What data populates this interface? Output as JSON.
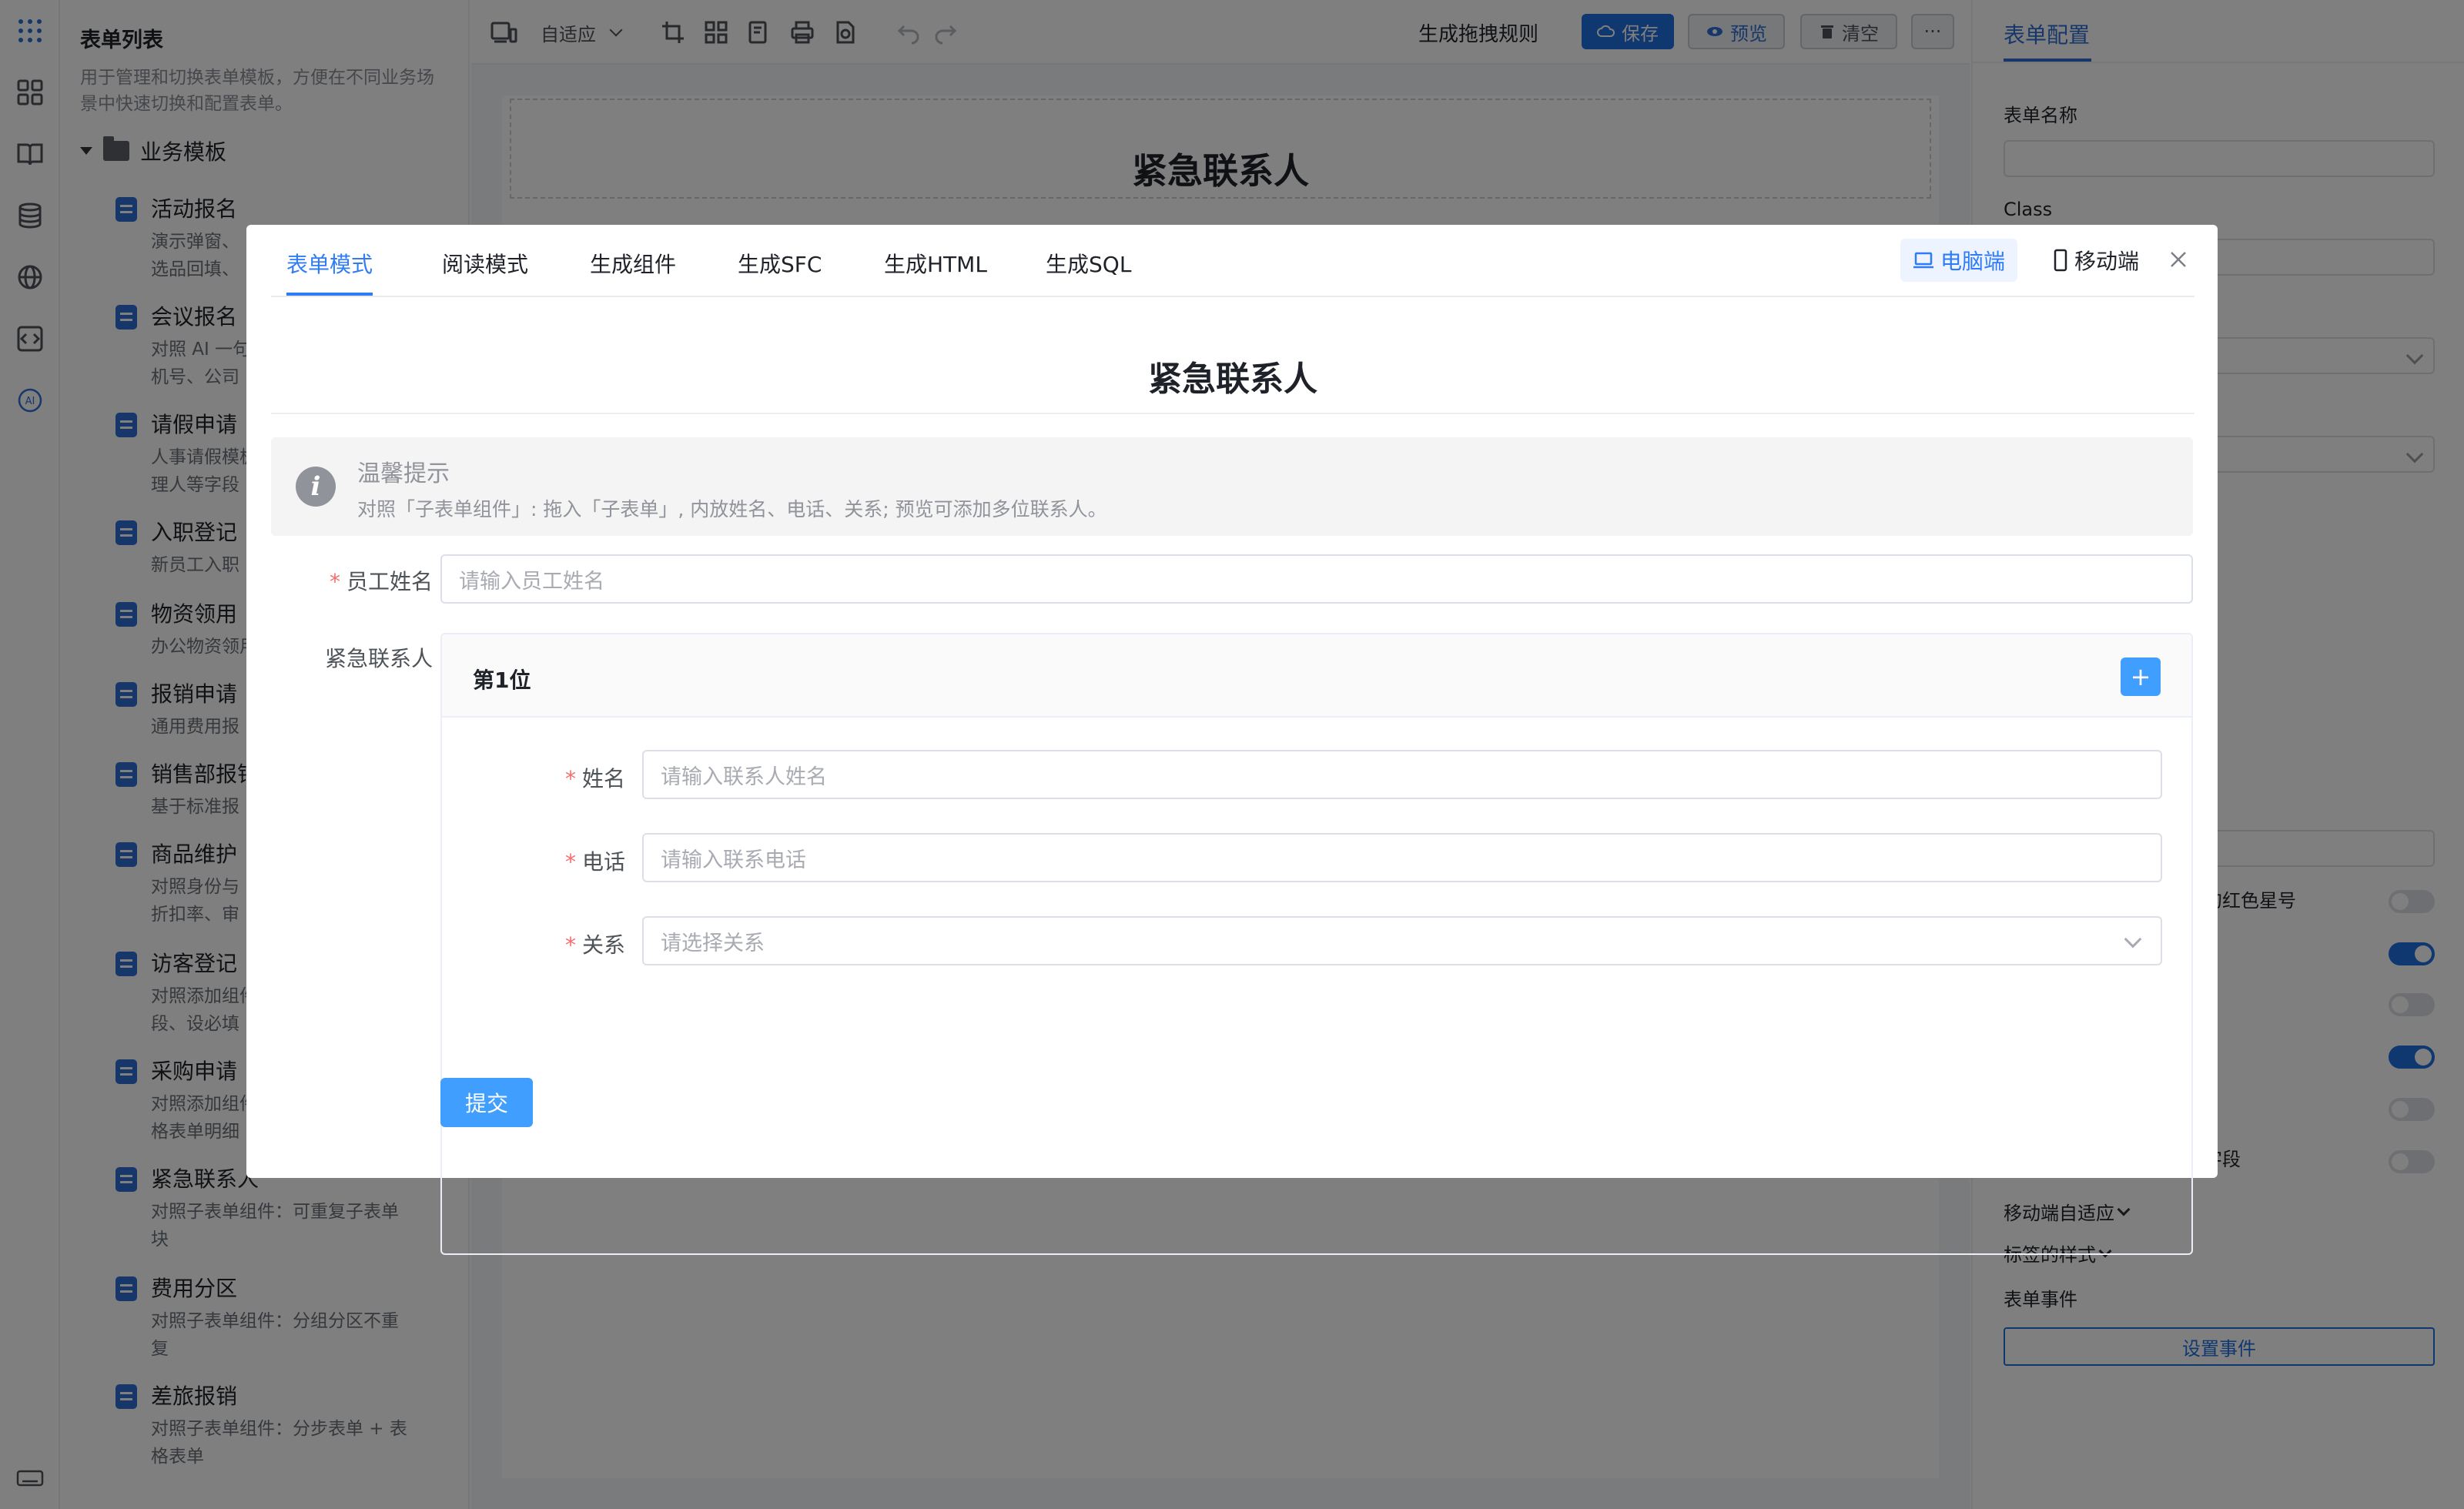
{
  "rail": {
    "icons": [
      "apps-grid-icon",
      "dashboard-icon",
      "book-icon",
      "database-icon",
      "globe-icon",
      "code-icon",
      "ai-icon",
      "keyboard-icon"
    ]
  },
  "tree": {
    "title": "表单列表",
    "desc": "用于管理和切换表单模板，方便在不同业务场景中快速切换和配置表单。",
    "group": "业务模板",
    "items": [
      {
        "name": "活动报名",
        "desc": "演示弹窗、\n选品回填、"
      },
      {
        "name": "会议报名",
        "desc": "对照 AI 一句\n机号、公司"
      },
      {
        "name": "请假申请",
        "desc": "人事请假模板\n理人等字段"
      },
      {
        "name": "入职登记",
        "desc": "新员工入职"
      },
      {
        "name": "物资领用",
        "desc": "办公物资领用"
      },
      {
        "name": "报销申请",
        "desc": "通用费用报"
      },
      {
        "name": "销售部报销",
        "desc": "基于标准报"
      },
      {
        "name": "商品维护",
        "desc": "对照身份与\n折扣率、审"
      },
      {
        "name": "访客登记",
        "desc": "对照添加组件\n段、设必填"
      },
      {
        "name": "采购申请",
        "desc": "对照添加组件\n格表单明细"
      },
      {
        "name": "紧急联系人",
        "desc": "对照子表单组件：可重复子表单块"
      },
      {
        "name": "费用分区",
        "desc": "对照子表单组件：分组分区不重复"
      },
      {
        "name": "差旅报销",
        "desc": "对照子表单组件：分步表单 + 表格表单"
      }
    ]
  },
  "toolbar": {
    "adapt": "自适应",
    "rules": "生成拖拽规则",
    "save": "保存",
    "preview": "预览",
    "clear": "清空",
    "more": "···"
  },
  "canvas": {
    "title": "紧急联系人"
  },
  "config": {
    "tab": "表单配置",
    "form_name_label": "表单名称",
    "form_name_value": "",
    "class_label": "Class",
    "id_value": "7bec8f8d9662",
    "red_star_label": "的红色星号",
    "field_label": "字段",
    "mobile_adapt": "移动端自适应",
    "label_style": "标签的样式",
    "form_events": "表单事件",
    "set_events": "设置事件",
    "toggles": [
      false,
      true,
      false,
      true,
      false,
      false
    ]
  },
  "modal": {
    "tabs": [
      "表单模式",
      "阅读模式",
      "生成组件",
      "生成SFC",
      "生成HTML",
      "生成SQL"
    ],
    "active_tab": 0,
    "desktop": "电脑端",
    "mobile": "移动端",
    "title": "紧急联系人",
    "tip_title": "温馨提示",
    "tip_text": "对照「子表单组件」: 拖入「子表单」, 内放姓名、电话、关系; 预览可添加多位联系人。",
    "employee_label": "员工姓名",
    "employee_placeholder": "请输入员工姓名",
    "contacts_label": "紧急联系人",
    "sub_title": "第1位",
    "add": "+",
    "name_label": "姓名",
    "name_placeholder": "请输入联系人姓名",
    "phone_label": "电话",
    "phone_placeholder": "请输入联系电话",
    "relation_label": "关系",
    "relation_placeholder": "请选择关系",
    "submit": "提交"
  }
}
